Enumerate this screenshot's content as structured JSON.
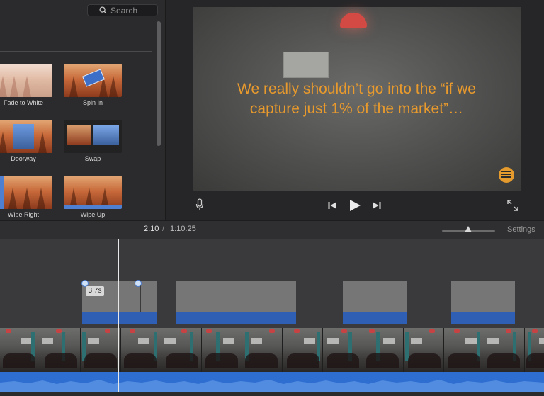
{
  "browser": {
    "search_placeholder": "Search",
    "transitions": [
      {
        "label": "Fade to White"
      },
      {
        "label": "Spin In"
      },
      {
        "label": "Doorway"
      },
      {
        "label": "Swap"
      },
      {
        "label": "Wipe Right"
      },
      {
        "label": "Wipe Up"
      }
    ]
  },
  "viewer": {
    "caption_line1": "We really shouldn’t go into the “if we",
    "caption_line2": "capture just 1% of the market”…",
    "icons": [
      "microphone-icon",
      "skip-back-icon",
      "play-icon",
      "skip-forward-icon",
      "fullscreen-icon"
    ]
  },
  "timeline": {
    "current_time": "2:10",
    "separator": "/",
    "total_time": "1:10:25",
    "settings_label": "Settings",
    "duration_tooltip": "3.7s",
    "accent_audio": "#2e6ed0",
    "accent_title": "#2f5fb5",
    "caption_color": "#e89a2d"
  }
}
